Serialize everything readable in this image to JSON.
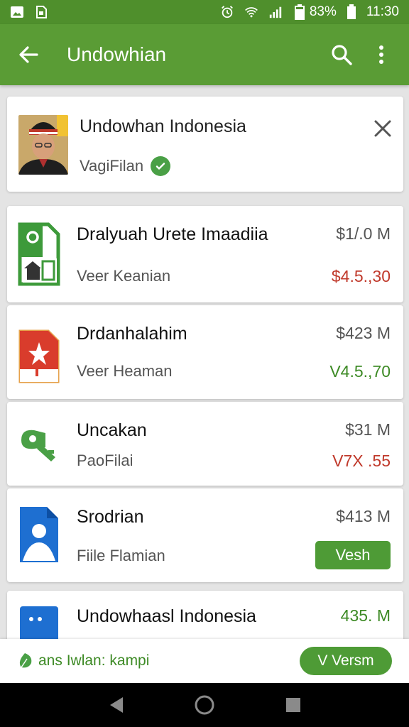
{
  "status_bar": {
    "battery": "83%",
    "time": "11:30",
    "icons": [
      "image-icon",
      "sd-card-icon",
      "alarm-icon",
      "wifi-icon",
      "signal-icon",
      "battery-icon"
    ]
  },
  "app_bar": {
    "title": "Undowhian",
    "icons": [
      "back-arrow-icon",
      "search-icon",
      "more-vert-icon"
    ]
  },
  "profile": {
    "name": "Undowhan Indonesia",
    "subtitle": "VagiFilan",
    "verified_icon": "check-circle-icon",
    "close_icon": "close-icon"
  },
  "rows": [
    {
      "icon": "spreadsheet-icon",
      "title": "Dralyuah Urete Imaadiia",
      "subtitle": "Veer Keanian",
      "price": "$1/.0 M",
      "change": "$4.5.,30",
      "change_color": "red"
    },
    {
      "icon": "pdf-document-icon",
      "title": "Drdanhalahim",
      "subtitle": "Veer Heaman",
      "price": "$423 M",
      "change": "V4.5.,70",
      "change_color": "green"
    },
    {
      "icon": "key-icon",
      "title": "Uncakan",
      "subtitle": "PaoFilai",
      "price": "$31 M",
      "change": "V7X .55",
      "change_color": "red"
    },
    {
      "icon": "contact-document-icon",
      "title": "Srodrian",
      "subtitle": "Fiile Flamian",
      "price": "$413 M",
      "button": "Vesh"
    },
    {
      "icon": "chat-icon",
      "title": "Undowhaasl Indonesia",
      "subtitle": "",
      "price": "435. M",
      "price_color": "green"
    }
  ],
  "bottom_banner": {
    "text": "ans Iwlan: kampi",
    "button": "V Versm",
    "icon": "leaf-icon"
  },
  "nav_bar": {
    "icons": [
      "back-triangle-icon",
      "home-circle-icon",
      "recents-square-icon"
    ]
  },
  "colors": {
    "app_bar": "#5a9c35",
    "status_bar": "#4f8f2c",
    "accent_green": "#4e9b36",
    "red": "#c0392b"
  }
}
